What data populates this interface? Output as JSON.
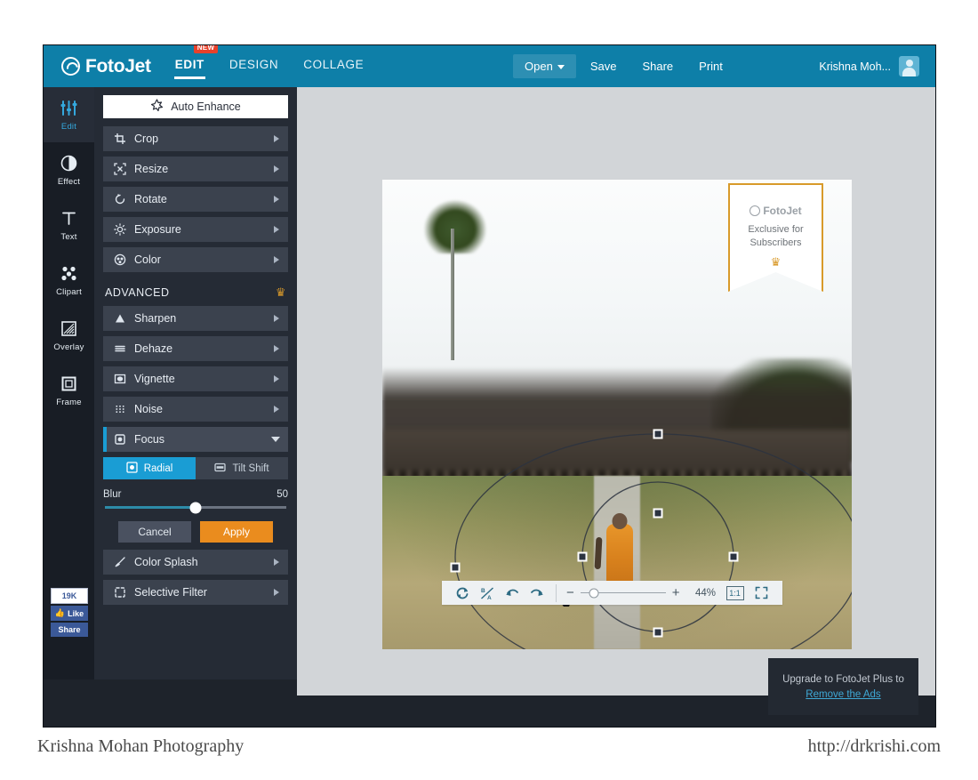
{
  "topbar": {
    "brand": "FotoJet",
    "nav": [
      {
        "label": "EDIT",
        "badge": "NEW",
        "active": true
      },
      {
        "label": "DESIGN",
        "active": false
      },
      {
        "label": "COLLAGE",
        "active": false
      }
    ],
    "actions": [
      {
        "label": "Open",
        "dropdown": true
      },
      {
        "label": "Save"
      },
      {
        "label": "Share"
      },
      {
        "label": "Print"
      }
    ],
    "account_name": "Krishna Moh...",
    "accent_color": "#0e7fa8"
  },
  "rail": {
    "items": [
      {
        "label": "Edit",
        "icon": "sliders-icon",
        "active": true
      },
      {
        "label": "Effect",
        "icon": "contrast-circle-icon",
        "active": false
      },
      {
        "label": "Text",
        "icon": "text-t-icon",
        "active": false
      },
      {
        "label": "Clipart",
        "icon": "dots-cluster-icon",
        "active": false
      },
      {
        "label": "Overlay",
        "icon": "overlay-hatch-icon",
        "active": false
      },
      {
        "label": "Frame",
        "icon": "frame-square-icon",
        "active": false
      }
    ],
    "facebook": {
      "count": "19K",
      "like_label": "Like",
      "share_label": "Share"
    }
  },
  "toolpanel": {
    "auto_enhance": "Auto Enhance",
    "basic_tools": [
      {
        "label": "Crop",
        "icon": "crop-icon"
      },
      {
        "label": "Resize",
        "icon": "resize-icon"
      },
      {
        "label": "Rotate",
        "icon": "rotate-icon"
      },
      {
        "label": "Exposure",
        "icon": "exposure-icon"
      },
      {
        "label": "Color",
        "icon": "color-icon"
      }
    ],
    "advanced_label": "ADVANCED",
    "advanced_tools_top": [
      {
        "label": "Sharpen",
        "icon": "sharpen-icon"
      },
      {
        "label": "Dehaze",
        "icon": "dehaze-icon"
      },
      {
        "label": "Vignette",
        "icon": "vignette-icon"
      },
      {
        "label": "Noise",
        "icon": "noise-icon"
      }
    ],
    "focus": {
      "label": "Focus",
      "icon": "focus-icon",
      "expanded": true,
      "tabs": [
        {
          "label": "Radial",
          "icon": "radial-icon",
          "active": true
        },
        {
          "label": "Tilt Shift",
          "icon": "tilt-shift-icon",
          "active": false
        }
      ],
      "slider_label": "Blur",
      "slider_value": "50",
      "slider_percent": 50,
      "cancel_label": "Cancel",
      "apply_label": "Apply",
      "apply_color": "#ea8c1e",
      "active_color": "#1a9dd4"
    },
    "advanced_tools_bottom": [
      {
        "label": "Color Splash",
        "icon": "brush-icon"
      },
      {
        "label": "Selective Filter",
        "icon": "selective-filter-icon"
      }
    ]
  },
  "canvas": {
    "ribbon": {
      "brand": "FotoJet",
      "line1": "Exclusive for",
      "line2": "Subscribers",
      "crown": "♛",
      "border_color": "#d89a2a"
    },
    "toolbar": {
      "buttons": [
        {
          "name": "reset-icon"
        },
        {
          "name": "compare-ba-icon"
        },
        {
          "name": "undo-icon"
        },
        {
          "name": "redo-icon"
        }
      ],
      "zoom_minus": "−",
      "zoom_plus": "+",
      "zoom_percent": "44%",
      "zoom_slider_percent": 16,
      "one_to_one_label": "1:1",
      "fit_screen_icon": "fit-screen-icon"
    },
    "gear_icon": "gear-icon"
  },
  "ad": {
    "text": "Upgrade to FotoJet Plus to",
    "link": "Remove the Ads"
  },
  "caption": {
    "left": "Krishna Mohan Photography",
    "right": "http://drkrishi.com"
  }
}
